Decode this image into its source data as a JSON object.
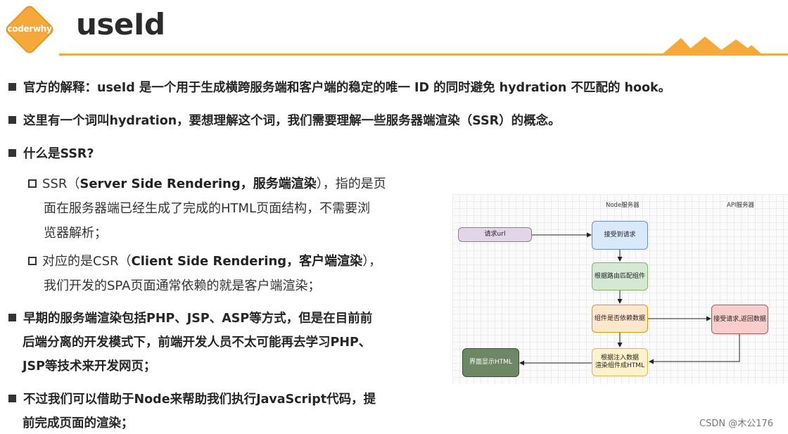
{
  "logo": {
    "text": "coderwhy"
  },
  "title": "useId",
  "bullets": {
    "b1": {
      "prefix": "官方的解释：",
      "text": "useId 是一个用于生成横跨服务端和客户端的稳定的唯一 ID 的同时避免 hydration 不匹配的 hook。"
    },
    "b2": "这里有一个词叫hydration，要想理解这个词，我们需要理解一些服务器端渲染（SSR）的概念。",
    "b3": "什么是SSR?",
    "ssr": {
      "pre": "SSR（",
      "bold": "Server Side Rendering，服务端渲染",
      "post": "），指的是页",
      "line2": "面在服务器端已经生成了完成的HTML页面结构，不需要浏",
      "line3": "览器解析；"
    },
    "csr": {
      "pre": "对应的是CSR（",
      "bold": "Client Side Rendering，客户端渲染",
      "post": "），",
      "line2": "我们开发的SPA页面通常依赖的就是客户端渲染；"
    },
    "b4": {
      "line1": "早期的服务端渲染包括PHP、JSP、ASP等方式，但是在目前前",
      "line2": "后端分离的开发模式下，前端开发人员不太可能再去学习PHP、",
      "line3": "JSP等技术来开发网页；"
    },
    "b5": {
      "line1": "不过我们可以借助于Node来帮助我们执行JavaScript代码，提",
      "line2": "前完成页面的渲染；"
    }
  },
  "diagram": {
    "col_node": "Node服务器",
    "col_api": "API服务器",
    "n_request": "请求url",
    "n_receive": "接受到请求",
    "n_route": "根据路由匹配组件",
    "n_depend": "组件是否依赖数据",
    "n_api": "接受请求,返回数据",
    "n_inject_1": "根据注入数据",
    "n_inject_2": "渲染组件成HTML",
    "n_display": "界面显示HTML"
  },
  "footer": "CSDN @木公176",
  "colors": {
    "accent": "#f4a93a"
  }
}
